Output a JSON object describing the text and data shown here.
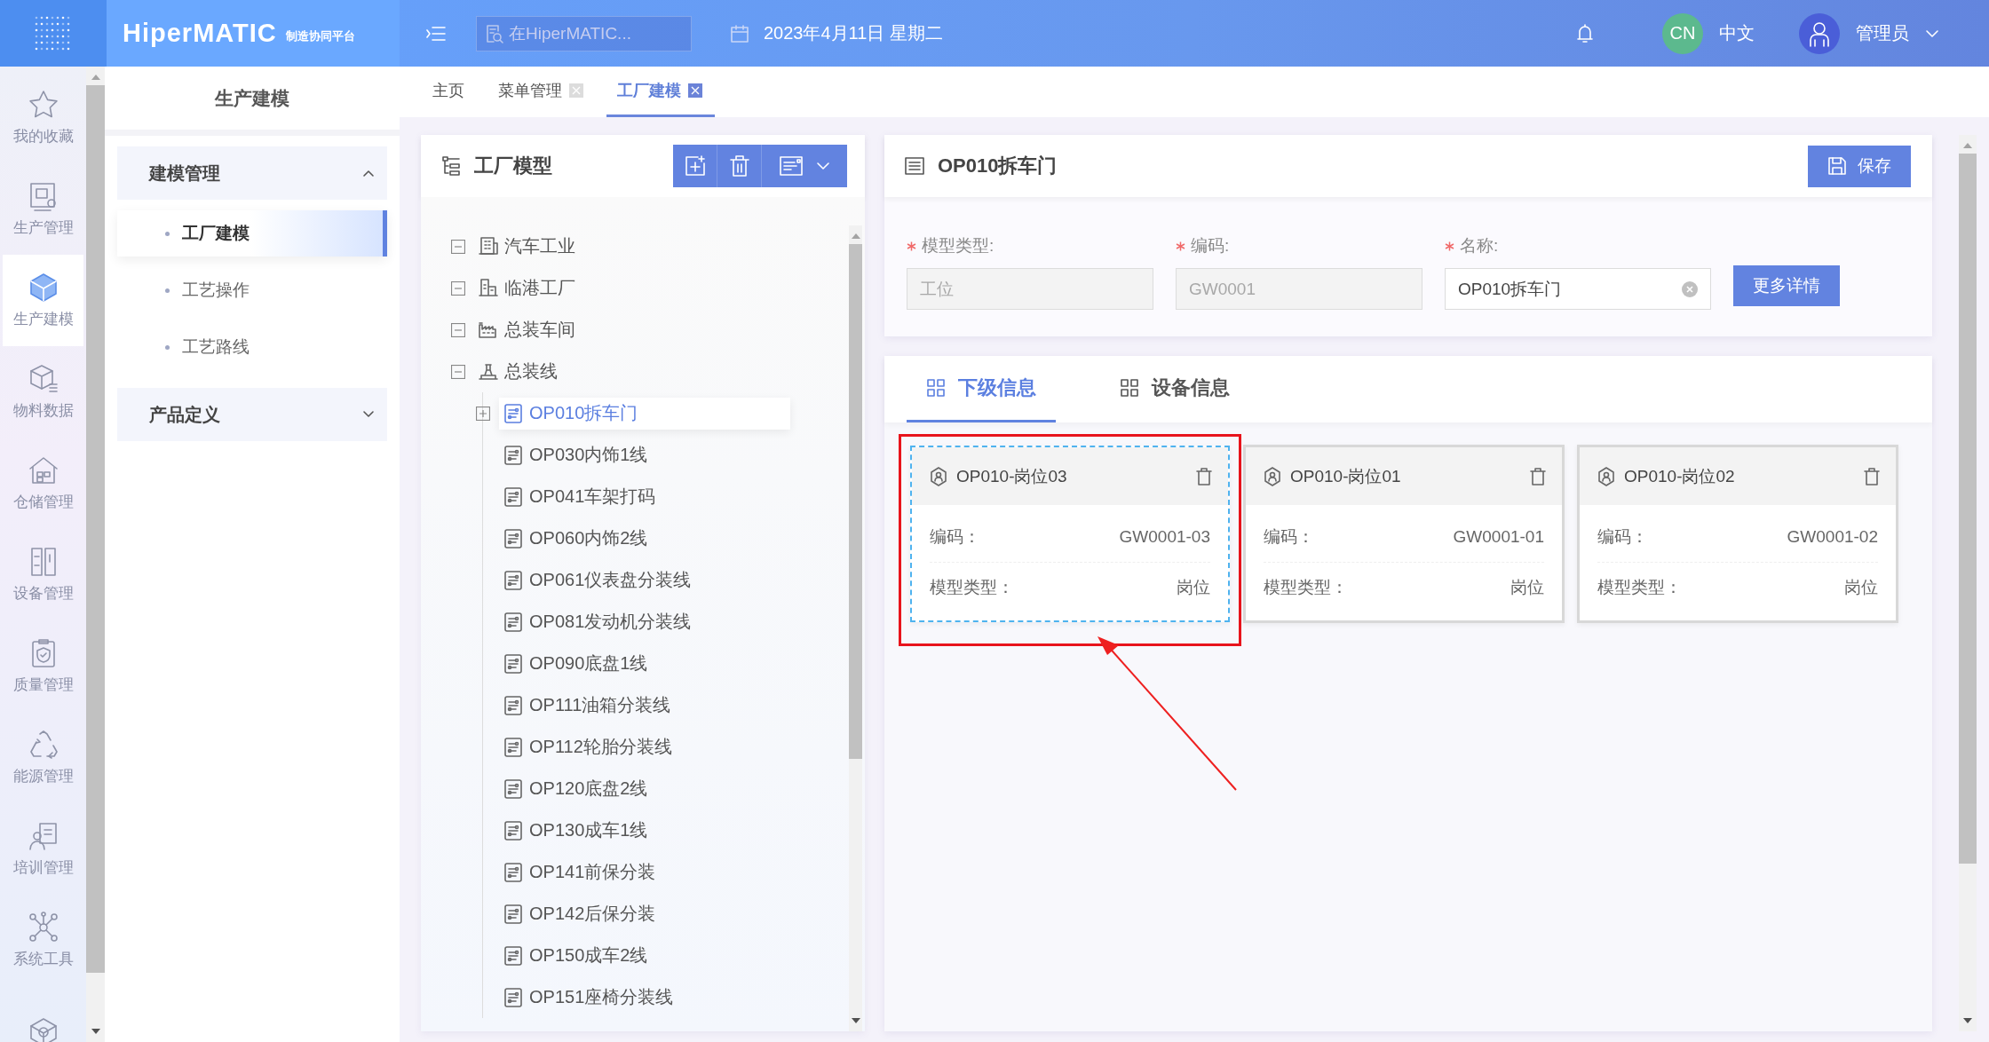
{
  "header": {
    "logo": "HiperMATIC",
    "logo_subtitle": "制造协同平台",
    "search": {
      "placeholder": "在HiperMATIC..."
    },
    "date": "2023年4月11日 星期二",
    "language_badge": "CN",
    "language": "中文",
    "user": "管理员"
  },
  "rail": {
    "items": [
      {
        "label": "我的收藏",
        "kind": "star",
        "selected": false
      },
      {
        "label": "生产管理",
        "kind": "production",
        "selected": false
      },
      {
        "label": "生产建模",
        "kind": "modeling",
        "selected": true
      },
      {
        "label": "物料数据",
        "kind": "material",
        "selected": false
      },
      {
        "label": "仓储管理",
        "kind": "warehouse",
        "selected": false
      },
      {
        "label": "设备管理",
        "kind": "equipment",
        "selected": false
      },
      {
        "label": "质量管理",
        "kind": "quality",
        "selected": false
      },
      {
        "label": "能源管理",
        "kind": "energy",
        "selected": false
      },
      {
        "label": "培训管理",
        "kind": "training",
        "selected": false
      },
      {
        "label": "系统工具",
        "kind": "tools",
        "selected": false
      },
      {
        "kind": "system",
        "selected": false
      }
    ]
  },
  "side_menu": {
    "title": "生产建模",
    "groups": [
      {
        "label": "建模管理",
        "expanded": true,
        "children": [
          {
            "label": "工厂建模",
            "selected": true
          },
          {
            "label": "工艺操作",
            "selected": false
          },
          {
            "label": "工艺路线",
            "selected": false
          }
        ]
      },
      {
        "label": "产品定义",
        "expanded": false
      }
    ]
  },
  "tabs": [
    {
      "label": "主页",
      "selected": false,
      "closable": false
    },
    {
      "label": "菜单管理",
      "selected": false,
      "closable": true
    },
    {
      "label": "工厂建模",
      "selected": true,
      "closable": true
    }
  ],
  "tree_panel": {
    "title": "工厂模型",
    "nodes": [
      {
        "label": "汽车工业",
        "kind": "enterprise",
        "expanded": true,
        "selected": false,
        "children": [
          {
            "label": "临港工厂",
            "kind": "factory",
            "expanded": true,
            "selected": false,
            "children": [
              {
                "label": "总装车间",
                "kind": "workshop",
                "expanded": true,
                "selected": false,
                "children": [
                  {
                    "label": "总装线",
                    "kind": "line",
                    "expanded": true,
                    "selected": false,
                    "children": [
                      {
                        "label": "OP010拆车门",
                        "kind": "station",
                        "expanded": false,
                        "selected": true
                      },
                      {
                        "label": "OP030内饰1线",
                        "kind": "station",
                        "selected": false
                      },
                      {
                        "label": "OP041车架打码",
                        "kind": "station",
                        "selected": false
                      },
                      {
                        "label": "OP060内饰2线",
                        "kind": "station",
                        "selected": false
                      },
                      {
                        "label": "OP061仪表盘分装线",
                        "kind": "station",
                        "selected": false
                      },
                      {
                        "label": "OP081发动机分装线",
                        "kind": "station",
                        "selected": false
                      },
                      {
                        "label": "OP090底盘1线",
                        "kind": "station",
                        "selected": false
                      },
                      {
                        "label": "OP111油箱分装线",
                        "kind": "station",
                        "selected": false
                      },
                      {
                        "label": "OP112轮胎分装线",
                        "kind": "station",
                        "selected": false
                      },
                      {
                        "label": "OP120底盘2线",
                        "kind": "station",
                        "selected": false
                      },
                      {
                        "label": "OP130成车1线",
                        "kind": "station",
                        "selected": false
                      },
                      {
                        "label": "OP141前保分装",
                        "kind": "station",
                        "selected": false
                      },
                      {
                        "label": "OP142后保分装",
                        "kind": "station",
                        "selected": false
                      },
                      {
                        "label": "OP150成车2线",
                        "kind": "station",
                        "selected": false
                      },
                      {
                        "label": "OP151座椅分装线",
                        "kind": "station",
                        "selected": false
                      }
                    ]
                  }
                ]
              }
            ]
          }
        ]
      }
    ]
  },
  "detail": {
    "title": "OP010拆车门",
    "save": "保存",
    "more": "更多详情",
    "fields": [
      {
        "label": "模型类型:",
        "value": "工位",
        "required": true,
        "disabled": true,
        "clearable": false
      },
      {
        "label": "编码:",
        "value": "GW0001",
        "required": true,
        "disabled": true,
        "clearable": false
      },
      {
        "label": "名称:",
        "value": "OP010拆车门",
        "required": true,
        "disabled": false,
        "clearable": true
      }
    ]
  },
  "sub_tabs": [
    {
      "label": "下级信息",
      "selected": true
    },
    {
      "label": "设备信息",
      "selected": false
    }
  ],
  "cards": [
    {
      "title": "OP010-岗位03",
      "selected": true,
      "highlighted": true,
      "rows": [
        {
          "label": "编码：",
          "value": "GW0001-03"
        },
        {
          "label": "模型类型：",
          "value": "岗位"
        }
      ]
    },
    {
      "title": "OP010-岗位01",
      "selected": false,
      "highlighted": false,
      "rows": [
        {
          "label": "编码：",
          "value": "GW0001-01"
        },
        {
          "label": "模型类型：",
          "value": "岗位"
        }
      ]
    },
    {
      "title": "OP010-岗位02",
      "selected": false,
      "highlighted": false,
      "rows": [
        {
          "label": "编码：",
          "value": "GW0001-02"
        },
        {
          "label": "模型类型：",
          "value": "岗位"
        }
      ]
    }
  ]
}
